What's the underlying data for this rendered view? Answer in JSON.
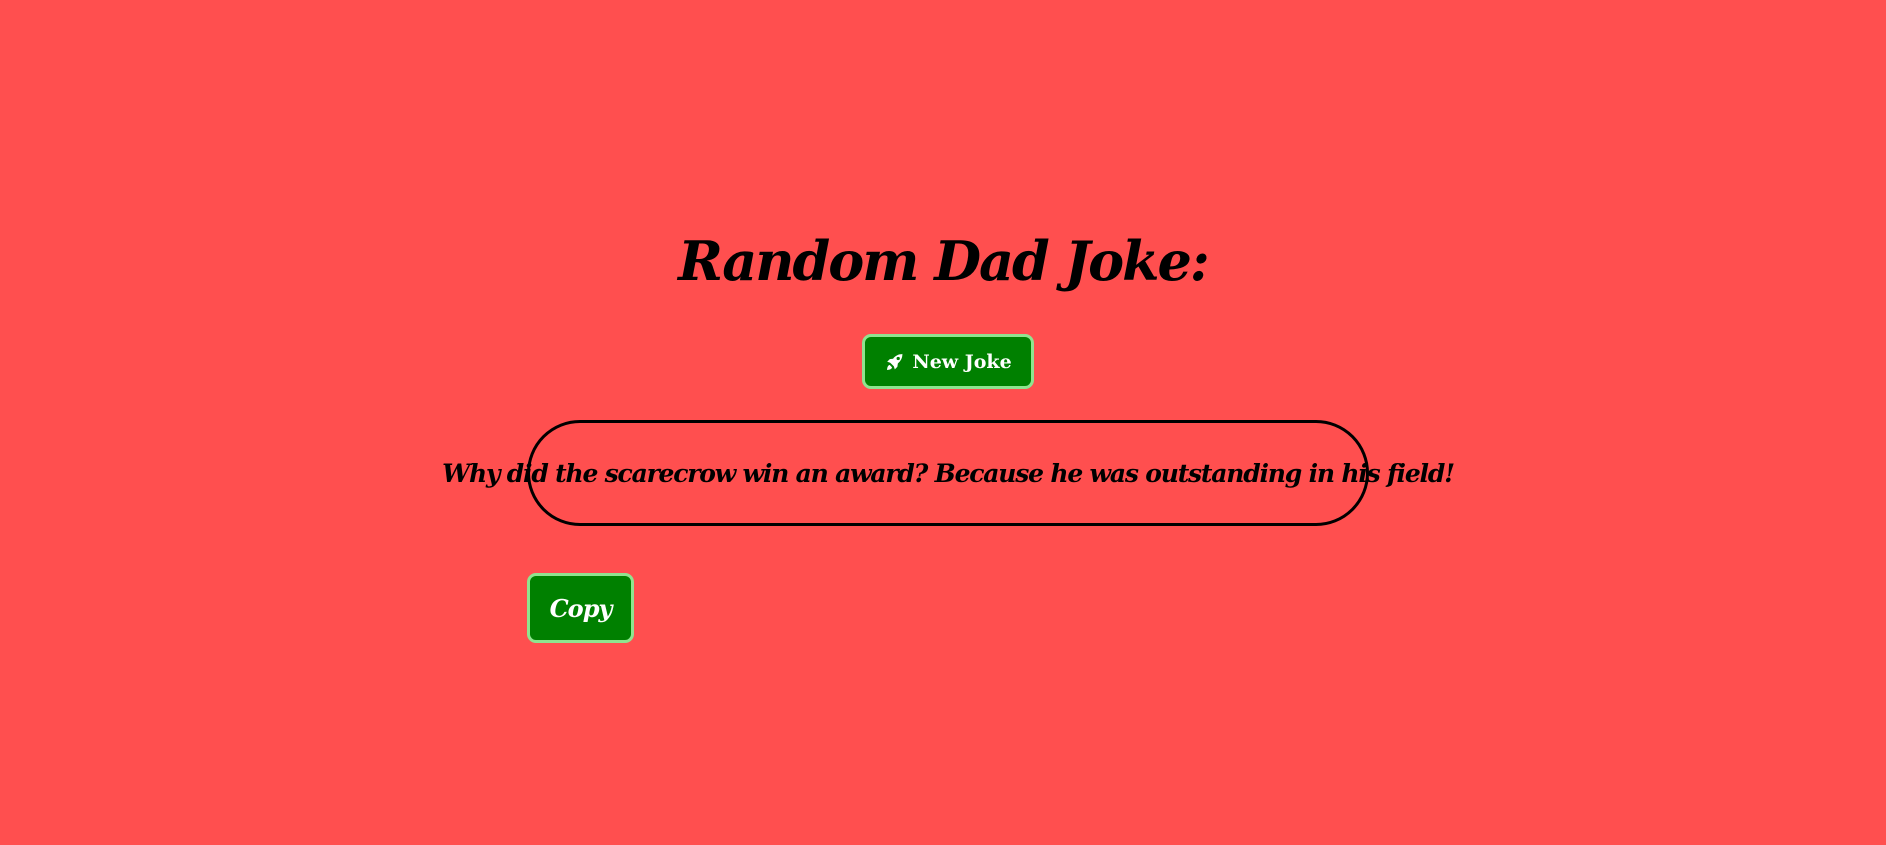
{
  "page": {
    "title": "Random Dad Joke:",
    "background_color": "#ff4f4f"
  },
  "new_joke_button": {
    "label": "New Joke",
    "icon": "rocket-icon",
    "color": "#008000",
    "border_color": "#8fe48f"
  },
  "joke": {
    "text": "Why did the scarecrow win an award? Because he was outstanding in his field!"
  },
  "copy_button": {
    "label": "Copy",
    "color": "#008000",
    "border_color": "#8fe48f"
  }
}
